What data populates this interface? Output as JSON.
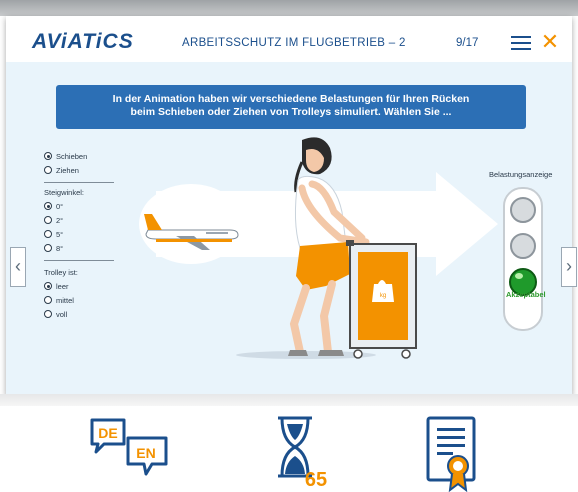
{
  "header": {
    "logo": "AViATiCS",
    "course_title": "ARBEITSSCHUTZ IM FLUGBETRIEB – 2",
    "page_counter": "9/17"
  },
  "instruction": {
    "line1": "In der Animation haben wir verschiedene Belastungen für Ihren Rücken",
    "line2": "beim Schieben oder Ziehen von Trolleys simuliert. Wählen Sie ..."
  },
  "options": {
    "mode": [
      {
        "label": "Schieben",
        "selected": true
      },
      {
        "label": "Ziehen",
        "selected": false
      }
    ],
    "slope_label": "Steigwinkel:",
    "slope": [
      {
        "label": "0°",
        "selected": true
      },
      {
        "label": "2°",
        "selected": false
      },
      {
        "label": "5°",
        "selected": false
      },
      {
        "label": "8°",
        "selected": false
      }
    ],
    "trolley_label": "Trolley ist:",
    "trolley": [
      {
        "label": "leer",
        "selected": true
      },
      {
        "label": "mittel",
        "selected": false
      },
      {
        "label": "voll",
        "selected": false
      }
    ]
  },
  "scene": {
    "trolley_badge": "kg"
  },
  "gauge": {
    "label": "Belastungsanzeige",
    "status": "Akzeptabel",
    "active_light": "green"
  },
  "footer_icons": {
    "language_top": "DE",
    "language_bottom": "EN",
    "duration_minutes": "65"
  },
  "colors": {
    "brand_blue": "#1b4f8c",
    "accent_orange": "#f39200",
    "instruction_bg": "#2c6fb5",
    "status_green": "#2e9a2e"
  }
}
